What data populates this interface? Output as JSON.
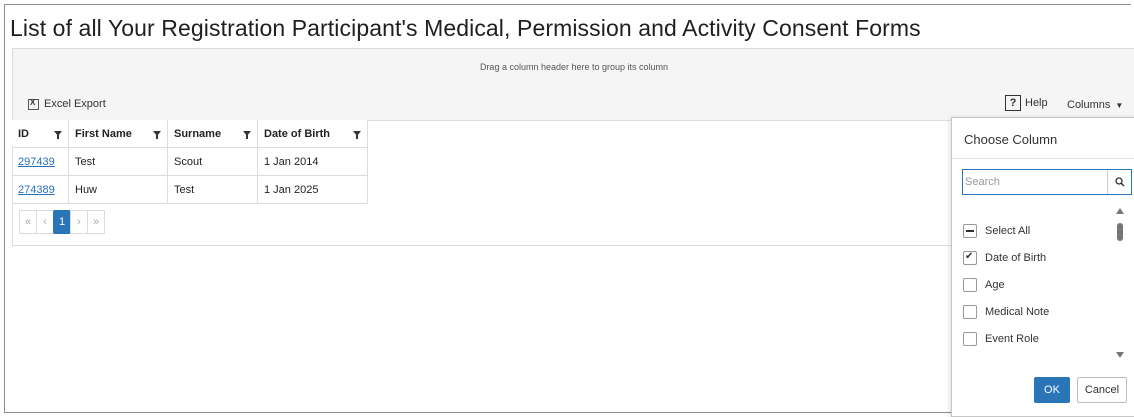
{
  "page": {
    "title": "List of all Your Registration Participant's Medical, Permission and Activity Consent Forms"
  },
  "group_panel": {
    "hint": "Drag a column header here to group its column"
  },
  "toolbar": {
    "excel_export": "Excel Export",
    "help": "Help",
    "columns": "Columns"
  },
  "grid": {
    "headers": [
      "ID",
      "First Name",
      "Surname",
      "Date of Birth"
    ],
    "rows": [
      {
        "id": "297439",
        "first_name": "Test",
        "surname": "Scout",
        "dob": "1 Jan 2014"
      },
      {
        "id": "274389",
        "first_name": "Huw",
        "surname": "Test",
        "dob": "1 Jan 2025"
      }
    ]
  },
  "pager": {
    "first": "«",
    "prev": "‹",
    "current": "1",
    "next": "›",
    "last": "»"
  },
  "column_chooser": {
    "title": "Choose Column",
    "search_placeholder": "Search",
    "options": [
      {
        "label": "Select All",
        "state": "indeterminate"
      },
      {
        "label": "Date of Birth",
        "state": "checked"
      },
      {
        "label": "Age",
        "state": "unchecked"
      },
      {
        "label": "Medical Note",
        "state": "unchecked"
      },
      {
        "label": "Event Role",
        "state": "unchecked"
      }
    ],
    "ok": "OK",
    "cancel": "Cancel"
  },
  "colors": {
    "accent": "#2a74b8",
    "link": "#2a6fbd"
  }
}
